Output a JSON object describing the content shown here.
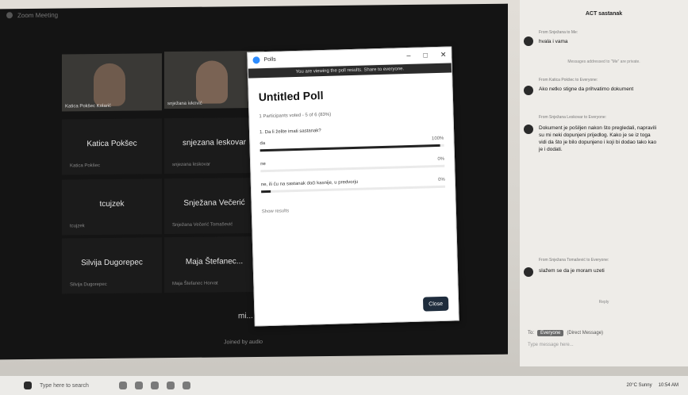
{
  "zoom": {
    "title": "Zoom Meeting",
    "video_tiles": [
      {
        "caption": "Katica Pokšec Kolarić"
      },
      {
        "caption": "snježana ivković"
      }
    ],
    "participants": [
      {
        "name": "Katica Pokšec",
        "sub": "Katica Pokšec"
      },
      {
        "name": "snjezana leskovar",
        "sub": "snjezana leskovar"
      },
      {
        "name": "tcujzek",
        "sub": "tcujzek"
      },
      {
        "name": "Snježana Večerić",
        "sub": "Snježana Večerić Tomašević"
      },
      {
        "name": "Silvija Dugorepec",
        "sub": "Silvija Dugorepec"
      },
      {
        "name": "Maja Štefanec...",
        "sub": "Maja Štefanec Horvat"
      }
    ],
    "bottom_name": "mi...",
    "bottom_status": "Joined by audio"
  },
  "poll": {
    "window_title": "Polls",
    "banner": "You are viewing the poll results. Share to everyone.",
    "title": "Untitled Poll",
    "meta": "1 Participants voted - 5 of 6 (83%)",
    "question": "1. Da li želite imati sastanak?",
    "options": [
      {
        "label": "da",
        "value": "100%",
        "fraction": 0.98
      },
      {
        "label": "ne",
        "value": "0%",
        "fraction": 0
      },
      {
        "label": "ne, ili ću na sastanak doći kasnije, u predvorju",
        "value": "0%",
        "fraction": 0.05
      }
    ],
    "footer": "Show results",
    "close_label": "Close"
  },
  "chat": {
    "title": "ACT sastanak",
    "messages": [
      {
        "sender": "From Snježana to Me:",
        "text": "hvala i vama"
      },
      {
        "sender": "From Katica Pokšec to Everyone:",
        "text": "Ako netko stigne da prihvatimo dokument"
      },
      {
        "sender": "From Snježana Leskovar to Everyone:",
        "text": "Dokument je pošiljen nakon što pregledali, napravili su mi neki dopunjeni prijedlog. Kako je se iz toga vidi da što je bilo dopunjeno i koji bi dodao tako kao je i dodati."
      },
      {
        "sender": "From Snježana Tomašević to Everyone:",
        "text": "slažem se da je moram uzeti"
      }
    ],
    "system_line": "Messages addressed to \"Me\" are private.",
    "reply_hint": "Reply",
    "to_label": "To:",
    "to_value": "Everyone",
    "to_extra": "(Direct Message)",
    "input_placeholder": "Type message here..."
  },
  "taskbar": {
    "search": "Type here to search",
    "weather": "20°C Sunny",
    "clock": "10:54 AM"
  }
}
